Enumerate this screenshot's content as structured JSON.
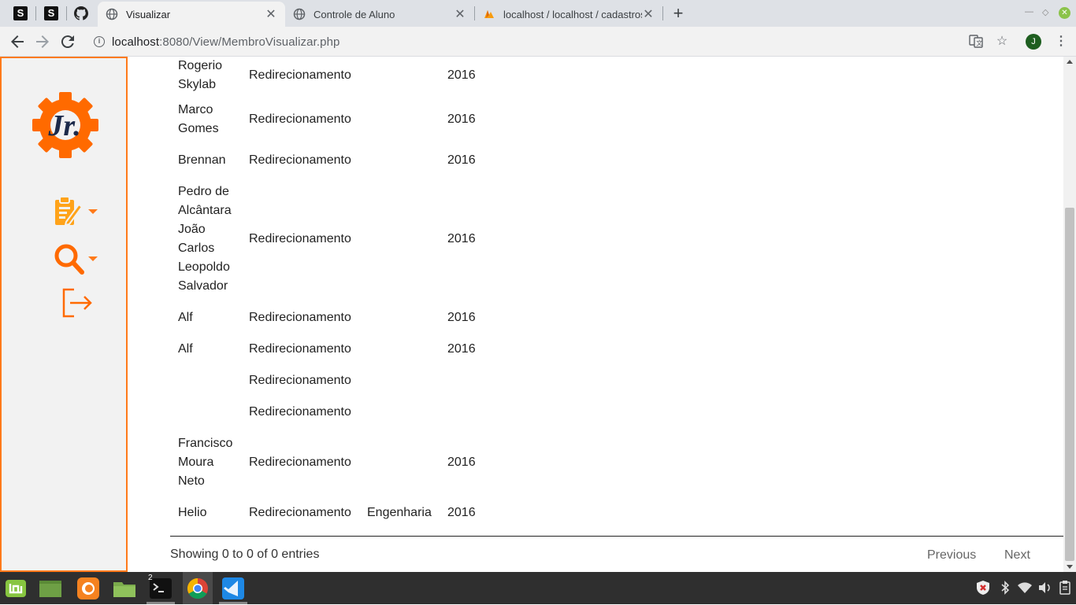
{
  "browser": {
    "pinned_tabs": [
      "S",
      "S"
    ],
    "tabs": [
      {
        "title": "Visualizar",
        "active": true
      },
      {
        "title": "Controle de Aluno",
        "active": false
      },
      {
        "title": "localhost / localhost / cadastros",
        "active": false
      }
    ],
    "close_glyph": "✕",
    "new_tab_glyph": "+",
    "url_host": "localhost",
    "url_path": ":8080/View/MembroVisualizar.php",
    "profile_initial": "J",
    "icons": [
      "back-icon",
      "forward-icon",
      "reload-icon",
      "info-icon",
      "translate-icon",
      "star-icon",
      "menu-icon"
    ]
  },
  "sidebar": {
    "logo_text": "Jr.",
    "accent_color": "#ff7a1a",
    "items": [
      {
        "icon": "clipboard-edit-icon",
        "has_dropdown": true
      },
      {
        "icon": "search-icon",
        "has_dropdown": true
      },
      {
        "icon": "logout-icon",
        "has_dropdown": false
      }
    ]
  },
  "table": {
    "rows": [
      {
        "name": "Rogerio Skylab",
        "name_lines": [
          "Rogerio",
          "Skylab"
        ],
        "tipo": "Redirecionamento",
        "area": "",
        "ano": "2016"
      },
      {
        "name": "Marco Gomes",
        "name_lines": [
          "Marco",
          "Gomes"
        ],
        "tipo": "Redirecionamento",
        "area": "",
        "ano": "2016"
      },
      {
        "name": "Brennan",
        "name_lines": [
          "Brennan"
        ],
        "tipo": "Redirecionamento",
        "area": "",
        "ano": "2016"
      },
      {
        "name": "Pedro de Alcântara João Carlos Leopoldo Salvador",
        "name_lines": [
          "Pedro de",
          "Alcântara",
          "João",
          "Carlos",
          "Leopoldo",
          "Salvador"
        ],
        "tipo": "Redirecionamento",
        "area": "",
        "ano": "2016"
      },
      {
        "name": "Alf",
        "name_lines": [
          "Alf"
        ],
        "tipo": "Redirecionamento",
        "area": "",
        "ano": "2016"
      },
      {
        "name": "Alf",
        "name_lines": [
          "Alf"
        ],
        "tipo": "Redirecionamento",
        "area": "",
        "ano": "2016"
      },
      {
        "name": "",
        "name_lines": [],
        "tipo": "Redirecionamento",
        "area": "",
        "ano": ""
      },
      {
        "name": "",
        "name_lines": [],
        "tipo": "Redirecionamento",
        "area": "",
        "ano": ""
      },
      {
        "name": "Francisco Moura Neto",
        "name_lines": [
          "Francisco",
          "Moura",
          "Neto"
        ],
        "tipo": "Redirecionamento",
        "area": "",
        "ano": "2016"
      },
      {
        "name": "Helio",
        "name_lines": [
          "Helio"
        ],
        "tipo": "Redirecionamento",
        "area": "Engenharia",
        "ano": "2016"
      }
    ],
    "info": "Showing 0 to 0 of 0 entries",
    "previous_label": "Previous",
    "next_label": "Next"
  },
  "taskbar": {
    "apps": [
      "mint-menu-icon",
      "show-desktop-icon",
      "firefox-icon",
      "files-icon",
      "terminal-icon",
      "chrome-icon",
      "vscode-icon"
    ],
    "terminal_badge": "2",
    "tray": [
      "security-icon",
      "bluetooth-icon",
      "wifi-icon",
      "volume-icon",
      "clipboard-icon"
    ]
  }
}
